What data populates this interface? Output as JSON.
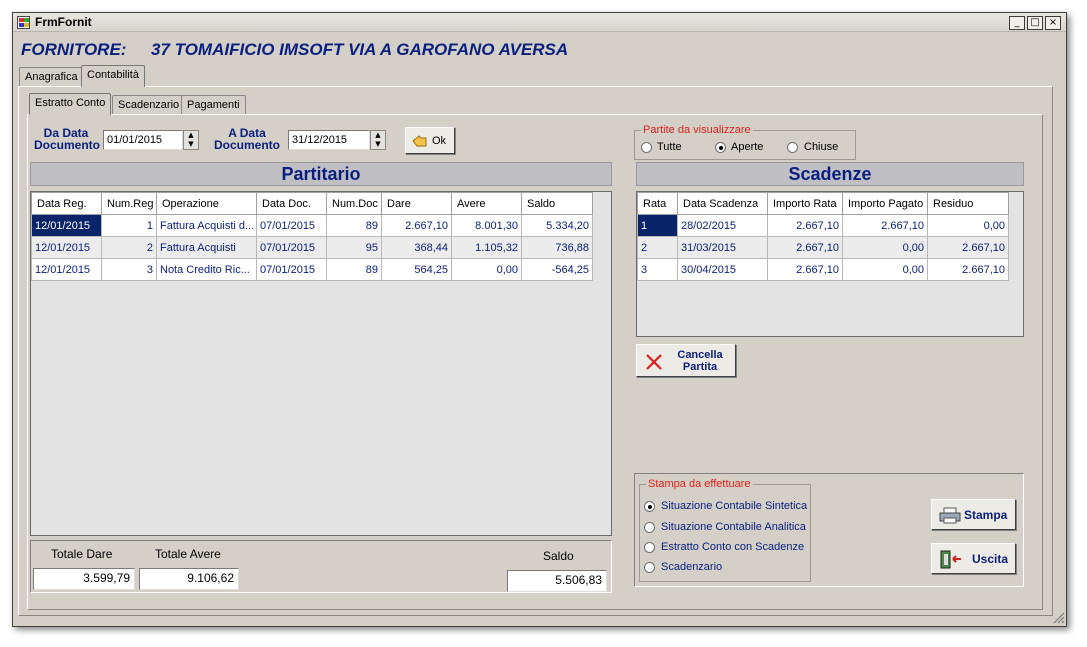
{
  "window": {
    "title": "FrmFornit",
    "controls": [
      "_",
      "□",
      "×"
    ]
  },
  "supplier": {
    "label": "FORNITORE:",
    "value": "37 TOMAIFICIO IMSOFT VIA A GAROFANO AVERSA"
  },
  "main_tabs": [
    "Anagrafica",
    "Contabilità"
  ],
  "sub_tabs": [
    "Estratto Conto",
    "Scadenzario",
    "Pagamenti"
  ],
  "filters": {
    "from_label_1": "Da Data",
    "from_label_2": "Documento",
    "from_value": "01/01/2015",
    "to_label_1": "A Data",
    "to_label_2": "Documento",
    "to_value": "31/12/2015",
    "ok_label": "Ok"
  },
  "partite": {
    "title": "Partite da visualizzare",
    "options": [
      "Tutte",
      "Aperte",
      "Chiuse"
    ],
    "selected": "Aperte"
  },
  "partitario": {
    "title": "Partitario",
    "columns": [
      "Data Reg.",
      "Num.Reg",
      "Operazione",
      "Data Doc.",
      "Num.Doc",
      "Dare",
      "Avere",
      "Saldo"
    ],
    "rows": [
      [
        "12/01/2015",
        "1",
        "Fattura Acquisti d...",
        "07/01/2015",
        "89",
        "2.667,10",
        "8.001,30",
        "5.334,20"
      ],
      [
        "12/01/2015",
        "2",
        "Fattura Acquisti",
        "07/01/2015",
        "95",
        "368,44",
        "1.105,32",
        "736,88"
      ],
      [
        "12/01/2015",
        "3",
        "Nota Credito Ric...",
        "07/01/2015",
        "89",
        "564,25",
        "0,00",
        "-564,25"
      ]
    ]
  },
  "scadenze": {
    "title": "Scadenze",
    "columns": [
      "Rata",
      "Data Scadenza",
      "Importo Rata",
      "Importo Pagato",
      "Residuo"
    ],
    "rows": [
      [
        "1",
        "28/02/2015",
        "2.667,10",
        "2.667,10",
        "0,00"
      ],
      [
        "2",
        "31/03/2015",
        "2.667,10",
        "0,00",
        "2.667,10"
      ],
      [
        "3",
        "30/04/2015",
        "2.667,10",
        "0,00",
        "2.667,10"
      ]
    ]
  },
  "cancella": {
    "line1": "Cancella",
    "line2": "Partita"
  },
  "stampa": {
    "title": "Stampa da effettuare",
    "options": [
      "Situazione Contabile Sintetica",
      "Situazione Contabile Analitica",
      "Estratto Conto con Scadenze",
      "Scadenzario"
    ],
    "selected": "Situazione Contabile Sintetica",
    "print_label": "Stampa",
    "exit_label": "Uscita"
  },
  "totals": {
    "dare_label": "Totale Dare",
    "dare_value": "3.599,79",
    "avere_label": "Totale Avere",
    "avere_value": "9.106,62",
    "saldo_label": "Saldo",
    "saldo_value": "5.506,83"
  },
  "colors": {
    "accent_blue": "#0a1e80",
    "selection": "#0a246a",
    "group_title_red": "#e0201a",
    "face": "#d4d0c8"
  }
}
